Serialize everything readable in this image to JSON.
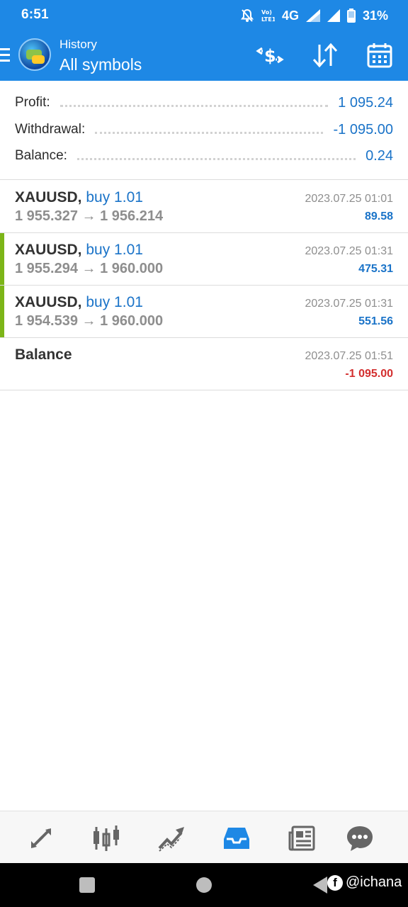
{
  "status_bar": {
    "time": "6:51",
    "network": "4G",
    "battery": "31%",
    "icons": [
      "mute-bell-icon",
      "volte-icon",
      "signal-icon",
      "signal-icon",
      "battery-icon"
    ]
  },
  "toolbar": {
    "subtitle": "History",
    "title": "All symbols",
    "icons": [
      "menu-icon",
      "app-logo",
      "currency-exchange-icon",
      "sort-icon",
      "calendar-icon"
    ]
  },
  "summary": {
    "rows": [
      {
        "label": "Profit:",
        "value": "1 095.24"
      },
      {
        "label": "Withdrawal:",
        "value": "-1 095.00"
      },
      {
        "label": "Balance:",
        "value": "0.24"
      }
    ]
  },
  "deals": [
    {
      "symbol": "XAUUSD,",
      "type": "buy 1.01",
      "prices": "1 955.327 → 1 956.214",
      "time": "2023.07.25 01:01",
      "profit": "89.58",
      "bar": false
    },
    {
      "symbol": "XAUUSD,",
      "type": "buy 1.01",
      "prices": "1 955.294 → 1 960.000",
      "time": "2023.07.25 01:31",
      "profit": "475.31",
      "bar": true
    },
    {
      "symbol": "XAUUSD,",
      "type": "buy 1.01",
      "prices": "1 954.539 → 1 960.000",
      "time": "2023.07.25 01:31",
      "profit": "551.56",
      "bar": true
    },
    {
      "symbol": "Balance",
      "type": "",
      "prices": "",
      "time": "2023.07.25 01:51",
      "profit": "-1 095.00",
      "bar": false
    }
  ],
  "bottom_nav": {
    "items": [
      "quotes-icon",
      "chart-icon",
      "trade-icon",
      "history-icon",
      "news-icon",
      "chat-icon"
    ],
    "active": "history-icon"
  },
  "watermark": {
    "text": "@ichana"
  },
  "colors": {
    "accent": "#1e88e5",
    "value_blue": "#1a73c8",
    "negative": "#d32f2f",
    "deal_bar": "#7cb518"
  }
}
